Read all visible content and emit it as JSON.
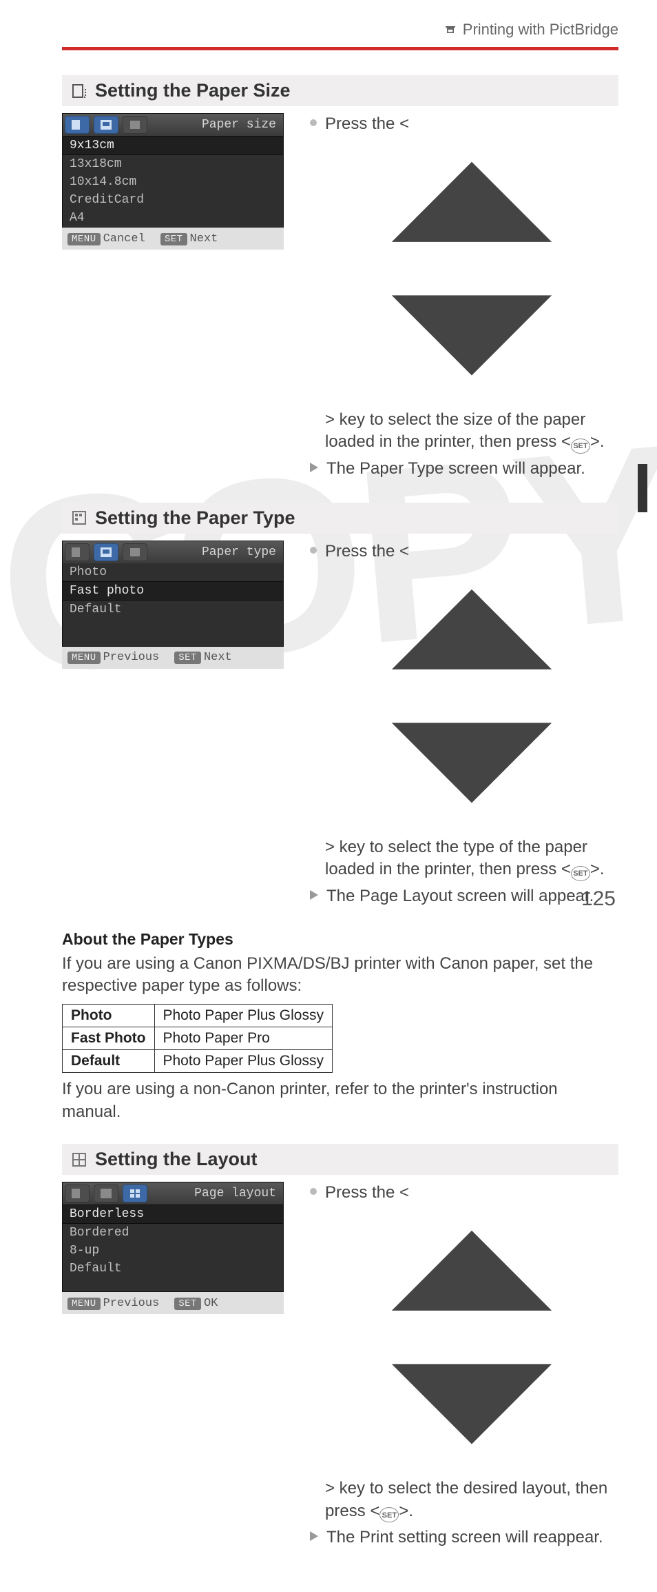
{
  "header": {
    "crumb_icon": "pictbridge-icon",
    "crumb_text": "Printing with PictBridge"
  },
  "section_size": {
    "title": "Setting the Paper Size",
    "screen_label": "Paper size",
    "options": [
      "9x13cm",
      "13x18cm",
      "10x14.8cm",
      "CreditCard",
      "A4"
    ],
    "foot_left_badge": "MENU",
    "foot_left": "Cancel",
    "foot_right_badge": "SET",
    "foot_right": "Next",
    "b1a": "Press the <",
    "b1b": "> key to select the size of the paper loaded in the printer, then press <",
    "b1c": ">.",
    "b2": "The Paper Type screen will appear."
  },
  "section_type": {
    "title": "Setting the Paper Type",
    "screen_label": "Paper type",
    "options": [
      "Photo",
      "Fast photo",
      "Default"
    ],
    "foot_left_badge": "MENU",
    "foot_left": "Previous",
    "foot_right_badge": "SET",
    "foot_right": "Next",
    "b1a": "Press the <",
    "b1b": "> key to select the type of the paper loaded in the printer, then press <",
    "b1c": ">.",
    "b2": "The Page Layout screen will appear."
  },
  "about": {
    "heading": "About the Paper Types",
    "intro": "If you are using a Canon PIXMA/DS/BJ printer with Canon paper, set the respective paper type as follows:",
    "rows": [
      {
        "k": "Photo",
        "v": "Photo Paper Plus Glossy"
      },
      {
        "k": "Fast Photo",
        "v": "Photo Paper Pro"
      },
      {
        "k": "Default",
        "v": "Photo Paper Plus Glossy"
      }
    ],
    "outro": "If you are using a non-Canon printer, refer to the printer's instruction manual."
  },
  "section_layout": {
    "title": "Setting the Layout",
    "screen_label": "Page layout",
    "options": [
      "Borderless",
      "Bordered",
      "8-up",
      "Default"
    ],
    "foot_left_badge": "MENU",
    "foot_left": "Previous",
    "foot_right_badge": "SET",
    "foot_right": "OK",
    "b1a": "Press the <",
    "b1b": "> key to select the desired layout, then press <",
    "b1c": ">.",
    "b2": "The Print setting screen will reappear."
  },
  "page_number": "125"
}
